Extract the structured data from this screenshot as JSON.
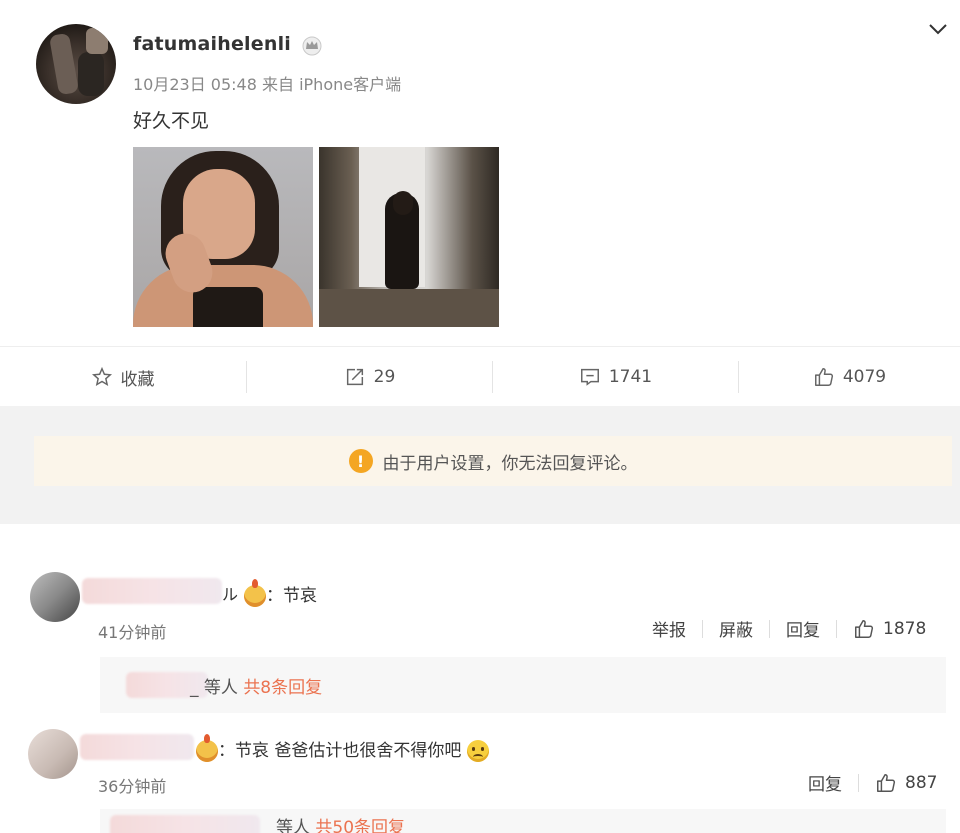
{
  "post": {
    "username": "fatumaihelenli",
    "meta": "10月23日 05:48 来自 iPhone客户端",
    "text": "好久不见"
  },
  "actions": {
    "favorite": "收藏",
    "repost_count": "29",
    "comment_count": "1741",
    "like_count": "4079"
  },
  "notice": {
    "text": "由于用户设置，你无法回复评论。"
  },
  "comments": [
    {
      "name_tail": "ル",
      "text": "：节哀",
      "time": "41分钟前",
      "report_label": "举报",
      "block_label": "屏蔽",
      "reply_label": "回复",
      "like_count": "1878",
      "reply_summary_name": "_",
      "reply_summary_prefix": "等人",
      "reply_summary_count": "共8条回复"
    },
    {
      "text": "：节哀 爸爸估计也很舍不得你吧",
      "time": "36分钟前",
      "reply_label": "回复",
      "like_count": "887",
      "reply_summary_prefix": "等人",
      "reply_summary_count": "共50条回复"
    }
  ],
  "colors": {
    "accent": "#eb7350",
    "notice_bg": "#fbf5ea",
    "warn": "#f4a623",
    "page_gray": "#f2f2f2"
  }
}
